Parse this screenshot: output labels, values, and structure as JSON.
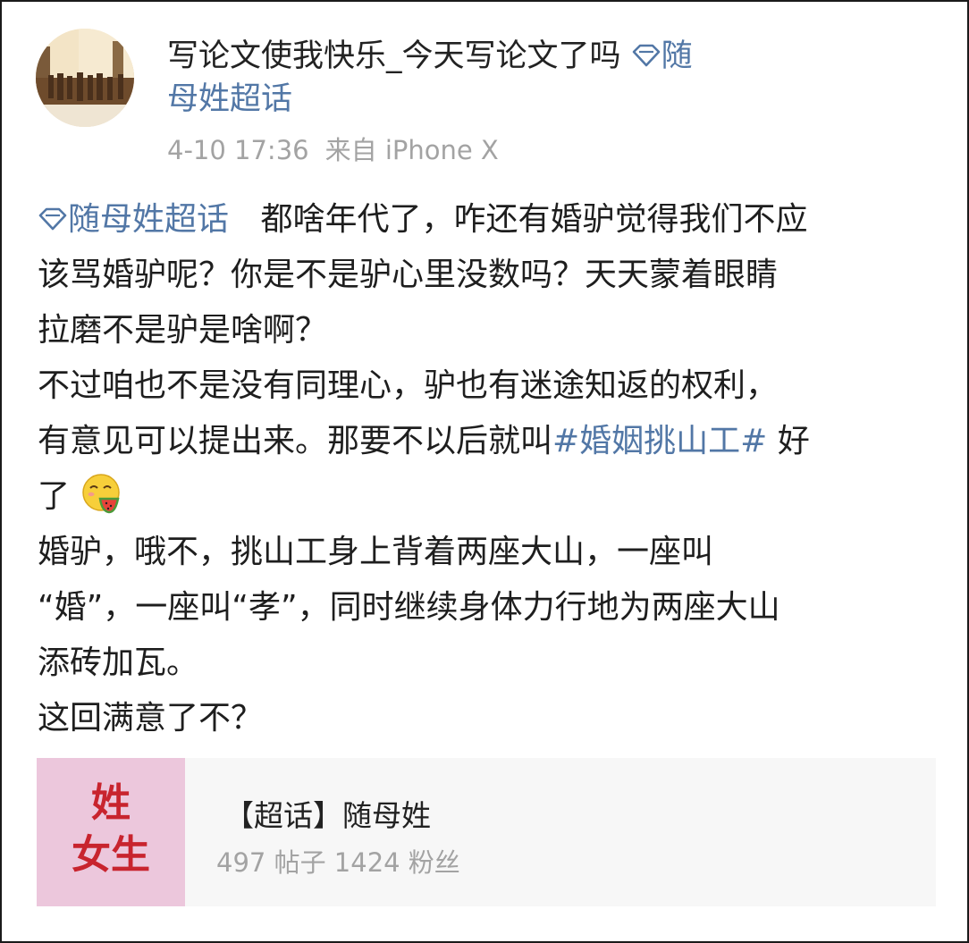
{
  "author": {
    "name": "写论文使我快乐_今天写论文了吗",
    "topic_line1": "随",
    "topic_line2": "母姓超话"
  },
  "meta": {
    "time": "4-10 17:36",
    "source": "来自 iPhone X"
  },
  "post": {
    "topic_tag": "随母姓超话",
    "l1": "都啥年代了，咋还有婚驴觉得我们不应",
    "l2": "该骂婚驴呢？你是不是驴心里没数吗？天天蒙着眼睛",
    "l3": "拉磨不是驴是啥啊？",
    "l4": "不过咱也不是没有同理心，驴也有迷途知返的权利，",
    "l5_pre": "有意见可以提出来。那要不以后就叫",
    "l5_hashtag": "#婚姻挑山工#",
    "l5_post": "好",
    "l6": "了",
    "l7": "婚驴，哦不，挑山工身上背着两座大山，一座叫",
    "l8": "“婚”，一座叫“孝”，同时继续身体力行地为两座大山",
    "l9": "添砖加瓦。",
    "l10": "这回满意了不？"
  },
  "card": {
    "thumb_line1": "姓",
    "thumb_line2": "女生",
    "title": "【超话】随母姓",
    "stats": "497 帖子 1424 粉丝"
  },
  "icons": {
    "topic": "diamond-gem-icon",
    "emoji": "eating-watermelon-emoji"
  },
  "colors": {
    "link": "#5277a6",
    "meta": "#a3a3a3",
    "thumb_bg": "#ecc7dc",
    "thumb_text": "#c8242e"
  }
}
